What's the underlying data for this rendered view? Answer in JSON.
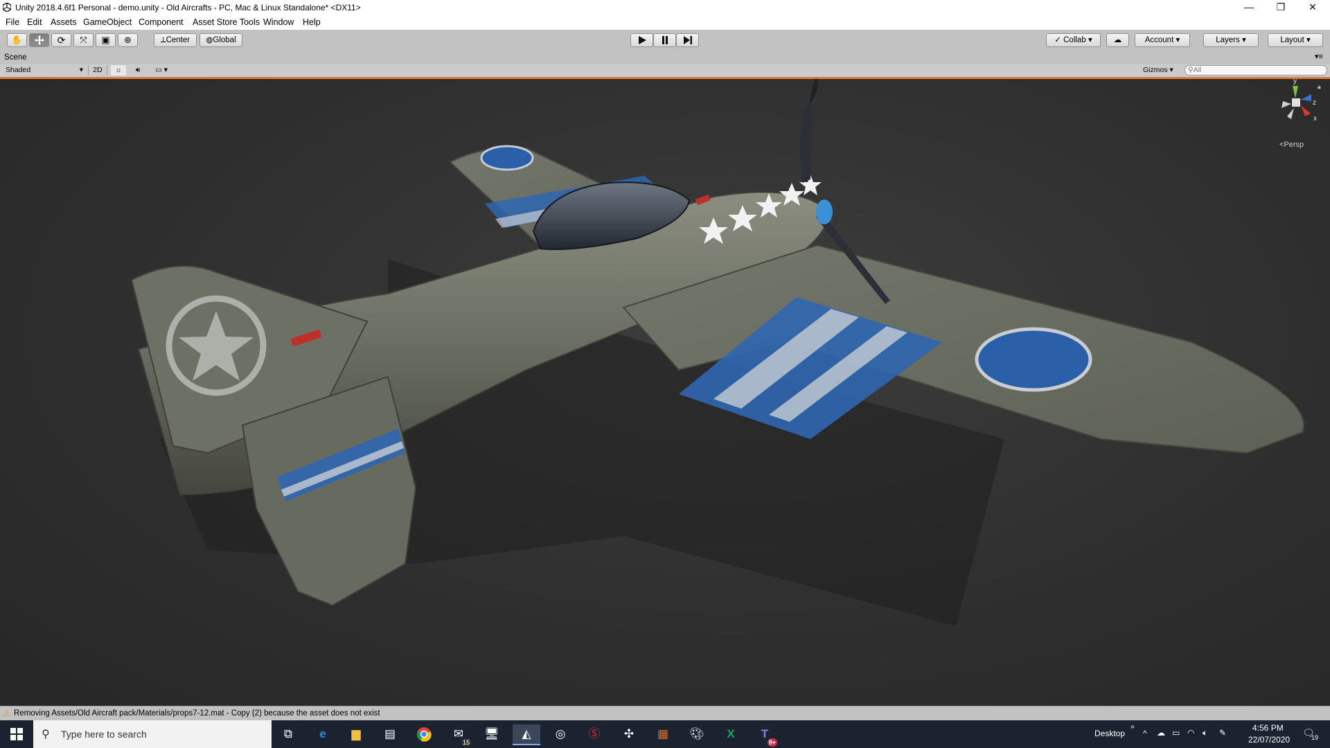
{
  "window": {
    "title": "Unity 2018.4.6f1 Personal - demo.unity - Old Aircrafts - PC, Mac & Linux Standalone* <DX11>",
    "controls": {
      "minimize": "—",
      "restore": "❐",
      "close": "✕"
    }
  },
  "menu": [
    "File",
    "Edit",
    "Assets",
    "GameObject",
    "Component",
    "Asset Store Tools",
    "Window",
    "Help"
  ],
  "toolbar": {
    "pivot_mode": "Center",
    "pivot_rotation": "Global",
    "play_icons": [
      "play-icon",
      "pause-icon",
      "step-icon"
    ],
    "collab": "Collab",
    "account": "Account",
    "layers": "Layers",
    "layout": "Layout"
  },
  "scene": {
    "tab_label": "Scene",
    "draw_mode": "Shaded",
    "toggle_2d": "2D",
    "gizmos": "Gizmos",
    "search_placeholder": "All",
    "projection": "Persp",
    "axes": {
      "y": "y",
      "z": "z",
      "x": "x"
    }
  },
  "status": {
    "message": "Removing Assets/Old Aircraft pack/Materials/props7-12.mat - Copy (2) because the asset does not exist"
  },
  "taskbar": {
    "search_placeholder": "Type here to search",
    "mail_badge": "15",
    "teams_badge": "9+",
    "desktop_label": "Desktop",
    "time": "4:56 PM",
    "date": "22/07/2020",
    "notification_count": "19"
  },
  "colors": {
    "title_bg": "#ffffff",
    "toolbar_bg": "#c2c2c2",
    "viewport_bg": "#2f2f2f",
    "accent_orange": "#e67a3a",
    "taskbar_bg": "#1c2330",
    "plane_body": "#6b6e62",
    "stripe_blue": "#2f66b0",
    "roundel_blue": "#2b5fa8"
  }
}
